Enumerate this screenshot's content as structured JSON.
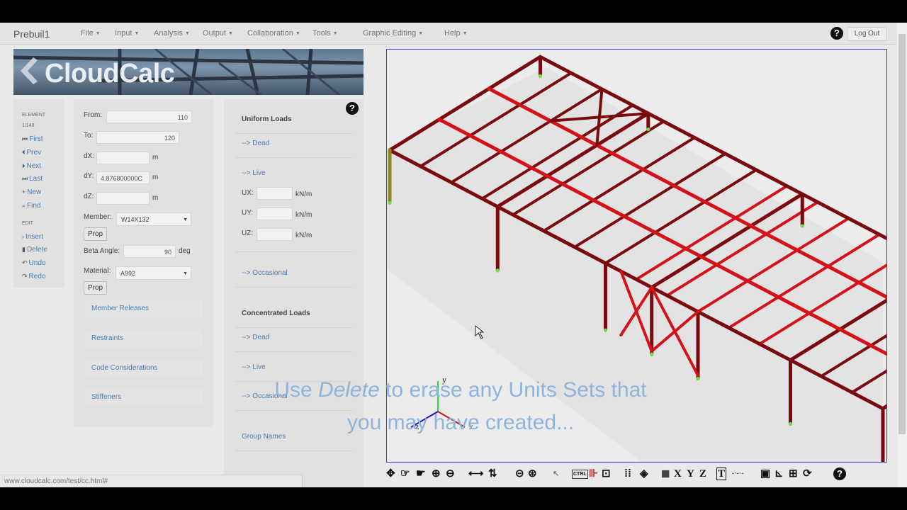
{
  "window": {
    "title": "Prebuil1"
  },
  "menu": [
    {
      "label": "File"
    },
    {
      "label": "Input"
    },
    {
      "label": "Analysis"
    },
    {
      "label": "Output"
    },
    {
      "label": "Collaboration"
    },
    {
      "label": "Tools"
    },
    {
      "label": "Graphic Editing"
    },
    {
      "label": "Help"
    }
  ],
  "header": {
    "help_glyph": "?",
    "logout_label": "Log Out"
  },
  "banner": {
    "logo": "CloudCalc"
  },
  "sidebar": {
    "element_heading": "ELEMENT",
    "element_count": "1/148",
    "nav": [
      {
        "label": "First",
        "icon": "first-icon"
      },
      {
        "label": "Prev",
        "icon": "prev-icon"
      },
      {
        "label": "Next",
        "icon": "next-icon"
      },
      {
        "label": "Last",
        "icon": "last-icon"
      },
      {
        "label": "New",
        "icon": "plus-icon"
      },
      {
        "label": "Find",
        "icon": "search-icon"
      }
    ],
    "edit_heading": "EDIT",
    "edit": [
      {
        "label": "Insert",
        "icon": "chevron-right-icon"
      },
      {
        "label": "Delete",
        "icon": "trash-icon"
      },
      {
        "label": "Undo",
        "icon": "undo-icon"
      },
      {
        "label": "Redo",
        "icon": "redo-icon"
      }
    ]
  },
  "form": {
    "from_label": "From:",
    "from_value": "110",
    "to_label": "To:",
    "to_value": "120",
    "dx_label": "dX:",
    "dx_value": "",
    "dx_unit": "m",
    "dy_label": "dY:",
    "dy_value": "4.876800000C",
    "dy_unit": "m",
    "dz_label": "dZ:",
    "dz_value": "",
    "dz_unit": "m",
    "member_label": "Member:",
    "member_value": "W14X132",
    "prop_label": "Prop",
    "beta_label": "Beta Angle:",
    "beta_value": "90",
    "beta_unit": "deg",
    "material_label": "Material:",
    "material_value": "A992",
    "sections": [
      "Member Releases",
      "Restraints",
      "Code Considerations",
      "Stiffeners"
    ]
  },
  "loads": {
    "uniform_heading": "Uniform Loads",
    "uniform_dead": "--> Dead",
    "uniform_live": "--> Live",
    "ux_label": "UX:",
    "uy_label": "UY:",
    "uz_label": "UZ:",
    "ux_value": "",
    "uy_value": "",
    "uz_value": "",
    "load_unit": "kN/m",
    "uniform_occasional": "--> Occasional",
    "conc_heading": "Concentrated Loads",
    "conc_dead": "--> Dead",
    "conc_live": "--> Live",
    "conc_occasional": "--> Occasional",
    "group_names": "Group Names"
  },
  "viewport": {
    "axis_x": "x",
    "axis_y": "y",
    "axis_z": "z",
    "caption_pre": "Use ",
    "caption_em": "Delete",
    "caption_post": " to erase any Units Sets that",
    "caption_line2": "you may have created...",
    "colors": {
      "frame_dark": "#7a0a0e",
      "frame_bright": "#d4121a",
      "support": "#6be34a",
      "selected": "#8a8a1e"
    }
  },
  "toolbar": {
    "icons": [
      "pan-icon",
      "pan-all-icon",
      "zoom-in-icon",
      "zoom-out-icon",
      "horizontal-arrow-icon",
      "vertical-arrow-icon",
      "magnify-minus-icon",
      "magnify-plus-icon",
      "pointer-icon",
      "ctrl-select-icon",
      "ruler-icon",
      "fit-icon",
      "grid-icon",
      "render-icon",
      "cube-icon",
      "text-icon",
      "chart-icon",
      "refresh-icon",
      "help-icon"
    ],
    "ctrl_label": "CTRL",
    "view_x": "X",
    "view_y": "Y",
    "view_z": "Z"
  },
  "status": {
    "url": "www.cloudcalc.com/test/cc.html#"
  }
}
